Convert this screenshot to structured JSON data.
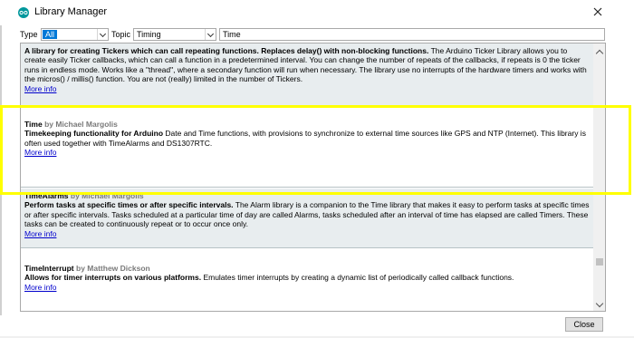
{
  "window": {
    "title": "Library Manager",
    "app_icon": "arduino-icon",
    "close_icon": "close-icon"
  },
  "filters": {
    "type_label": "Type",
    "type_value": "All",
    "topic_label": "Topic",
    "topic_value": "Timing",
    "search_value": "Time"
  },
  "libraries": [
    {
      "name": "",
      "author": "",
      "summary": "A library for creating Tickers which can call repeating functions. Replaces delay() with non-blocking functions.",
      "description": "The Arduino Ticker Library allows you to create easily Ticker callbacks, which can call a function in a predetermined interval. You can change the number of repeats of the callbacks, if repeats is 0 the ticker runs in endless mode. Works like a \"thread\", where a secondary function will run when necessary. The library use no interrupts of the hardware timers and works with the micros() / millis() function. You are not (really) limited in the number of Tickers.",
      "more_info": "More info"
    },
    {
      "name": "Time",
      "author": "by Michael Margolis",
      "summary": "Timekeeping functionality for Arduino",
      "description": "Date and Time functions, with provisions to synchronize to external time sources like GPS and NTP (Internet). This library is often used together with TimeAlarms and DS1307RTC.",
      "more_info": "More info"
    },
    {
      "name": "TimeAlarms",
      "author": "by Michael Margolis",
      "summary": "Perform tasks at specific times or after specific intervals.",
      "description": "The Alarm library is a companion to the Time library that makes it easy to perform tasks at specific times or after specific intervals. Tasks scheduled at a particular time of day are called Alarms, tasks scheduled after an interval of time has elapsed are called Timers. These tasks can be created to continuously repeat or to occur once only.",
      "more_info": "More info"
    },
    {
      "name": "TimeInterrupt",
      "author": "by Matthew Dickson",
      "summary": "Allows for timer interrupts on various platforms.",
      "description": "Emulates timer interrupts by creating a dynamic list of periodically called callback functions.",
      "more_info": "More info"
    }
  ],
  "footer": {
    "close_label": "Close"
  },
  "colors": {
    "highlight": "#ffff00",
    "link": "#0000cc",
    "author": "#7a7a7a",
    "row_gray": "#e8edef"
  }
}
